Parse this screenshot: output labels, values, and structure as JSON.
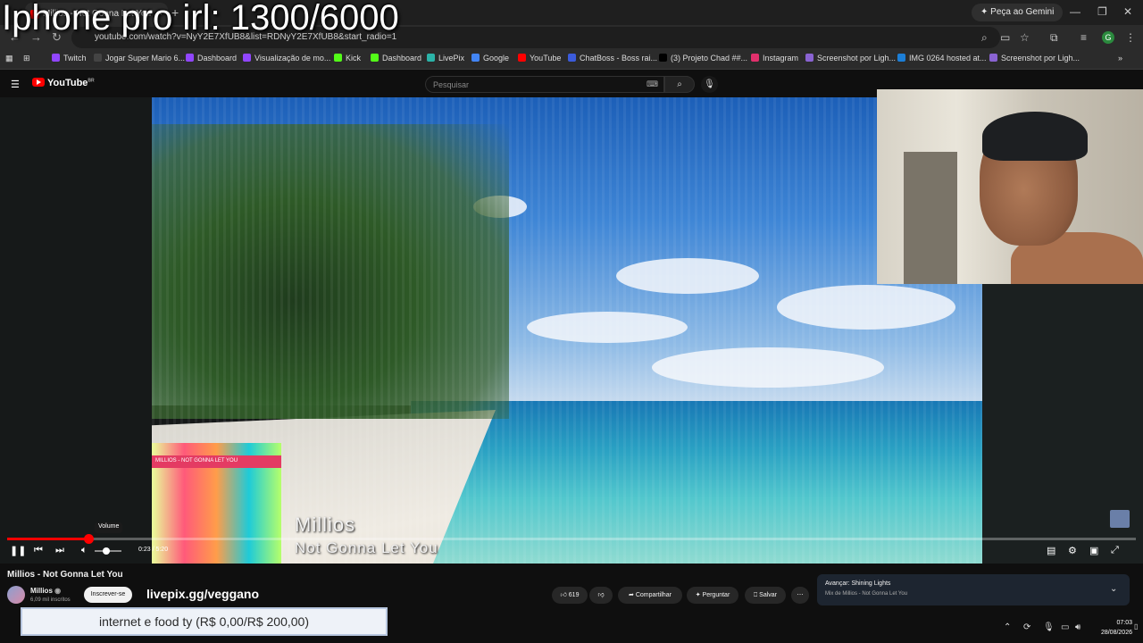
{
  "overlay_text": "Iphone pro irl: 1300/6000",
  "browser": {
    "tab_title": "Millios - Not Gonna Let You",
    "gemini_label": "Peça ao Gemini",
    "url": "youtube.com/watch?v=NyY2E7XfUB8&list=RDNyY2E7XfUB8&start_radio=1",
    "profile_initial": "G",
    "bookmarks": [
      {
        "label": "Twitch",
        "color": "#9146ff"
      },
      {
        "label": "Jogar Super Mario 6...",
        "color": "#444444"
      },
      {
        "label": "Dashboard",
        "color": "#9146ff"
      },
      {
        "label": "Visualização de mo...",
        "color": "#9146ff"
      },
      {
        "label": "Kick",
        "color": "#53fc18"
      },
      {
        "label": "Dashboard",
        "color": "#53fc18"
      },
      {
        "label": "LivePix",
        "color": "#2bb3a8"
      },
      {
        "label": "Google",
        "color": "#4285f4"
      },
      {
        "label": "YouTube",
        "color": "#ff0000"
      },
      {
        "label": "ChatBoss - Boss rai...",
        "color": "#3b5bdb"
      },
      {
        "label": "(3) Projeto Chad ##...",
        "color": "#000000"
      },
      {
        "label": "Instagram",
        "color": "#e1306c"
      },
      {
        "label": "Screenshot por Ligh...",
        "color": "#8a63d2"
      },
      {
        "label": "IMG 0264 hosted at...",
        "color": "#1c7ed6"
      },
      {
        "label": "Screenshot por Ligh...",
        "color": "#8a63d2"
      }
    ]
  },
  "youtube": {
    "logo": "YouTube",
    "logo_region": "BR",
    "search_placeholder": "Pesquisar"
  },
  "video": {
    "artist_overlay": "Millios",
    "song_overlay": "Not Gonna Let You",
    "thumb_strip_text": "MILLIOS - NOT GONNA LET YOU",
    "progress_fraction": 0.072,
    "volume_tooltip": "Volume",
    "time_display": "0:23 / 5:20"
  },
  "page": {
    "title": "Millios - Not Gonna Let You",
    "channel_name": "Millios",
    "subscribers": "6,09 mil inscritos",
    "subscribe_label": "Inscrever-se",
    "promo_text": "livepix.gg/veggano",
    "likes": "619",
    "share_label": "Compartilhar",
    "ask_label": "Perguntar",
    "save_label": "Salvar",
    "next_label": "Avançar: Shining Lights",
    "next_sub": "Mix de Millios - Not Gonna Let You"
  },
  "donation": "internet e food ty (R$ 0,00/R$ 200,00)",
  "taskbar": {
    "time": "07:03",
    "date": "28/08/2026"
  }
}
